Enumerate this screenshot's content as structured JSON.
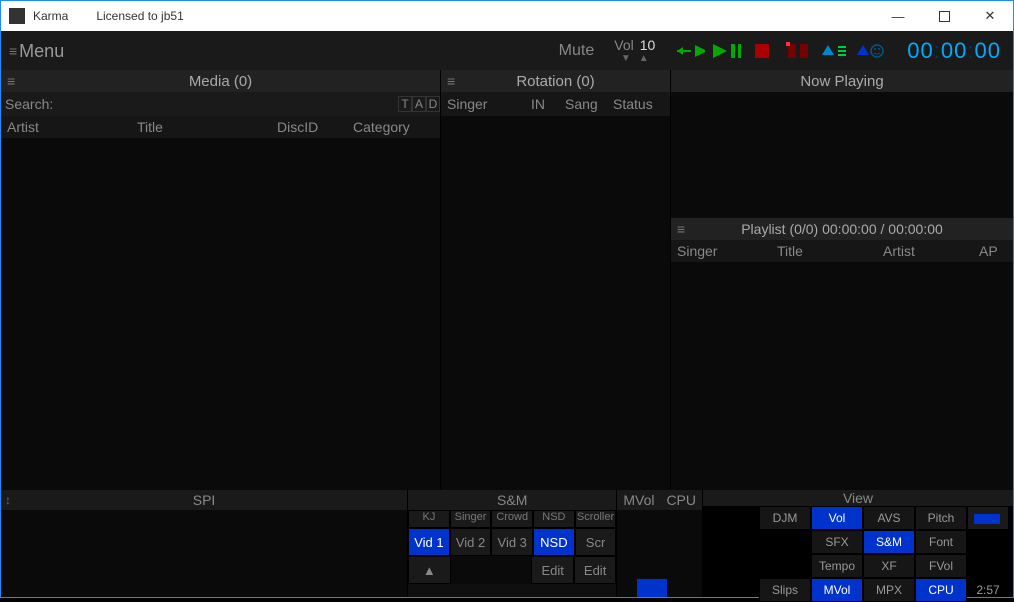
{
  "title": {
    "app": "Karma",
    "license": "Licensed to jb51"
  },
  "menu": "Menu",
  "mute": "Mute",
  "vol": {
    "label": "Vol",
    "value": "10"
  },
  "clock": "00:00:00",
  "panels": {
    "media": {
      "title": "Media (0)",
      "search": "Search:",
      "cols": {
        "artist": "Artist",
        "title": "Title",
        "discid": "DiscID",
        "category": "Category"
      },
      "tad": [
        "T",
        "A",
        "D"
      ]
    },
    "rotation": {
      "title": "Rotation (0)",
      "cols": {
        "singer": "Singer",
        "in": "IN",
        "sang": "Sang",
        "status": "Status"
      }
    },
    "now": {
      "title": "Now Playing"
    },
    "playlist": {
      "title": "Playlist (0/0)  00:00:00 / 00:00:00",
      "cols": {
        "singer": "Singer",
        "title": "Title",
        "artist": "Artist",
        "ap": "AP"
      }
    }
  },
  "bottom": {
    "spi": "SPI",
    "sm": {
      "title": "S&M",
      "row1": [
        "KJ",
        "Singer",
        "Crowd",
        "NSD",
        "Scroller"
      ],
      "row2": [
        "Vid 1",
        "Vid 2",
        "Vid 3",
        "NSD",
        "Scr"
      ],
      "edit": "Edit",
      "arrow": "▲"
    },
    "mvol": "MVol",
    "cpu": "CPU",
    "view": {
      "title": "View",
      "grid": [
        [
          "",
          "DJM",
          "Vol",
          "AVS",
          "Pitch"
        ],
        [
          "",
          "",
          "SFX",
          "S&M",
          "Font"
        ],
        [
          "",
          "",
          "Tempo",
          "XF",
          "FVol"
        ],
        [
          "",
          "Slips",
          "MVol",
          "MPX",
          "CPU"
        ]
      ],
      "active": [
        "Vol",
        "S&M",
        "MVol",
        "CPU"
      ],
      "time": "2:57"
    }
  }
}
